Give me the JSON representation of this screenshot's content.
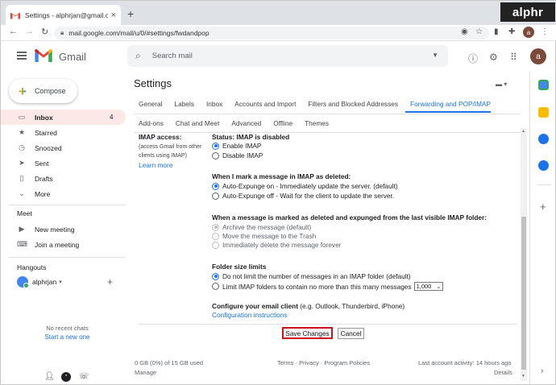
{
  "browser": {
    "tab_title": "Settings - alphrjan@gmail.com -",
    "close_glyph": "×",
    "new_tab_glyph": "+",
    "url": "mail.google.com/mail/u/0/#settings/fwdandpop",
    "profile_initial": "a",
    "watermark": "alphr"
  },
  "gmail": {
    "app_name": "Gmail",
    "search_placeholder": "Search mail",
    "avatar_initial": "a",
    "compose_label": "Compose",
    "nav": [
      {
        "label": "Inbox",
        "count": "4",
        "icon": "inbox-icon",
        "glyph": "▭"
      },
      {
        "label": "Starred",
        "count": "",
        "icon": "star-icon",
        "glyph": "★"
      },
      {
        "label": "Snoozed",
        "count": "",
        "icon": "clock-icon",
        "glyph": "◷"
      },
      {
        "label": "Sent",
        "count": "",
        "icon": "send-icon",
        "glyph": "➤"
      },
      {
        "label": "Drafts",
        "count": "",
        "icon": "draft-icon",
        "glyph": "▯"
      },
      {
        "label": "More",
        "count": "",
        "icon": "chevron-down-icon",
        "glyph": "⌄"
      }
    ],
    "meet_header": "Meet",
    "meet_items": [
      {
        "label": "New meeting",
        "icon": "video-icon",
        "glyph": "▶"
      },
      {
        "label": "Join a meeting",
        "icon": "keyboard-icon",
        "glyph": "⌨"
      }
    ],
    "hangouts_header": "Hangouts",
    "hangouts_user": "alphrjan",
    "hangouts_caret": "▾",
    "hangouts_plus": "+",
    "no_recent": "No recent chats",
    "start_new": "Start a new one"
  },
  "settings": {
    "title": "Settings",
    "tabs_row1": [
      "General",
      "Labels",
      "Inbox",
      "Accounts and Import",
      "Filters and Blocked Addresses",
      "Forwarding and POP/IMAP"
    ],
    "tabs_row2": [
      "Add-ons",
      "Chat and Meet",
      "Advanced",
      "Offline",
      "Themes"
    ],
    "active_tab": "Forwarding and POP/IMAP",
    "imap_label": "IMAP access:",
    "imap_note_1": "(access Gmail from other",
    "imap_note_2": "clients using IMAP)",
    "learn_more": "Learn more",
    "status": "Status: IMAP is disabled",
    "enable_imap": "Enable IMAP",
    "disable_imap": "Disable IMAP",
    "deleted_heading": "When I mark a message in IMAP as deleted:",
    "auto_expunge_on": "Auto-Expunge on - Immediately update the server. (default)",
    "auto_expunge_off": "Auto-Expunge off - Wait for the client to update the server.",
    "expunged_heading": "When a message is marked as deleted and expunged from the last visible IMAP folder:",
    "archive": "Archive the message (default)",
    "move_trash": "Move the message to the Trash",
    "delete_forever": "Immediately delete the message forever",
    "folder_heading": "Folder size limits",
    "no_limit": "Do not limit the number of messages in an IMAP folder (default)",
    "limit_folders": "Limit IMAP folders to contain no more than this many messages",
    "limit_value": "1,000",
    "configure_heading": "Configure your email client",
    "configure_examples": "(e.g. Outlook, Thunderbird, iPhone)",
    "config_instructions": "Configuration instructions",
    "save_button": "Save Changes",
    "cancel_button": "Cancel"
  },
  "footer": {
    "storage": "0 GB (0%) of 15 GB used",
    "manage": "Manage",
    "terms": "Terms",
    "privacy": "Privacy",
    "policies": "Program Policies",
    "sep": "·",
    "last_activity": "Last account activity: 14 hours ago",
    "details": "Details"
  },
  "colors": {
    "accent": "#1a73e8",
    "highlight_border": "#d0121c"
  }
}
